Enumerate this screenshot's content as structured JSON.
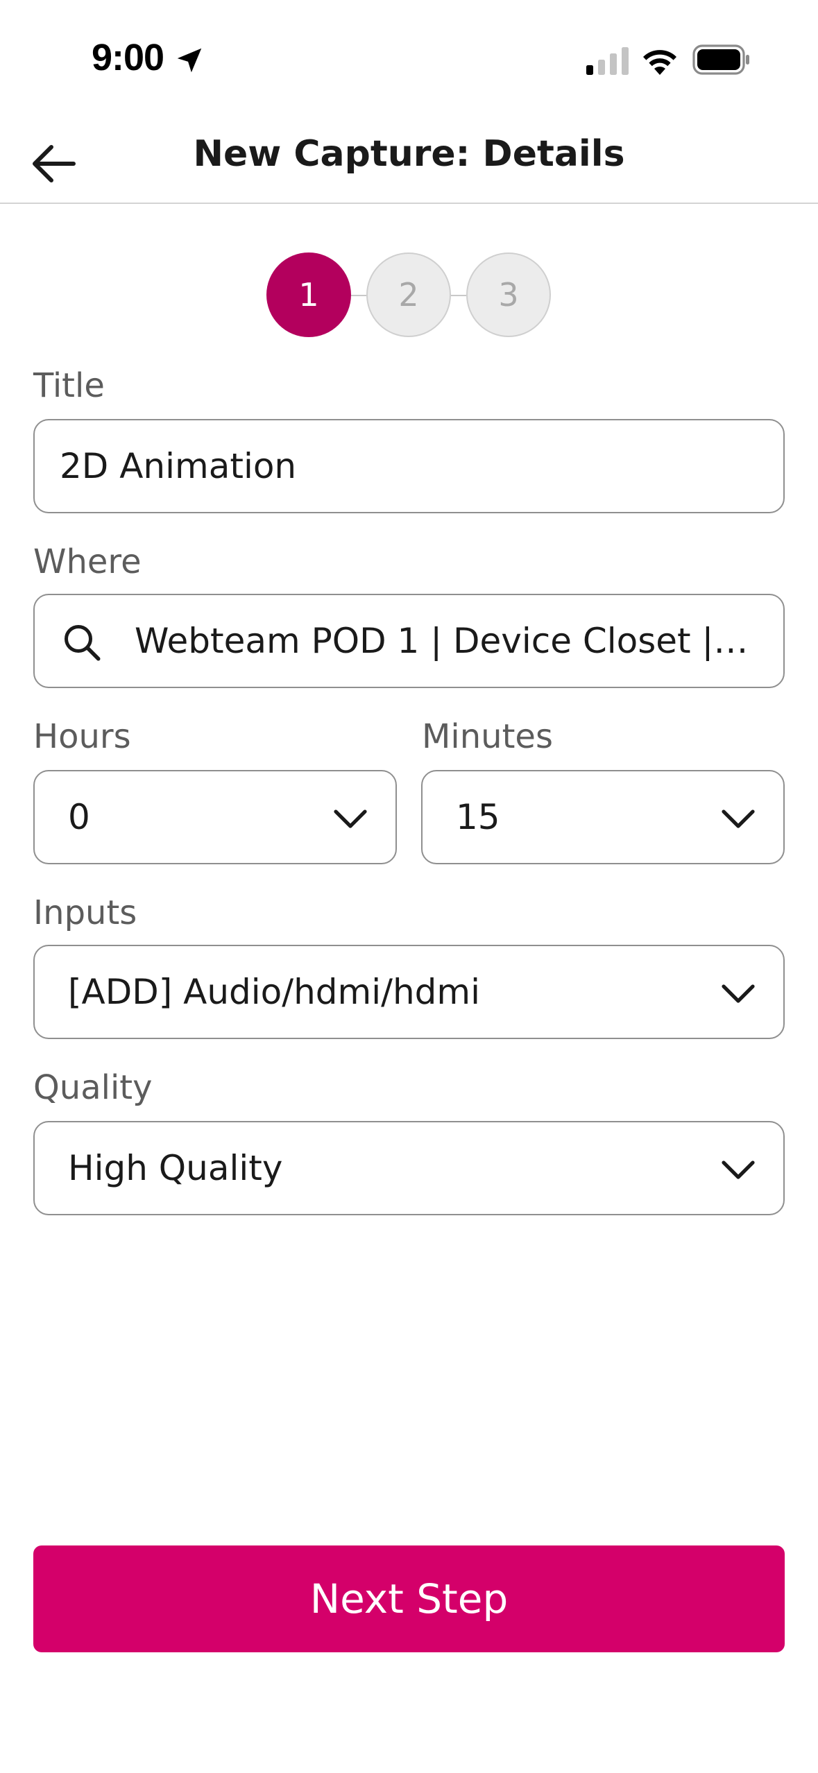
{
  "status_bar": {
    "time": "9:00",
    "icons": [
      "location-arrow-icon",
      "cellular-signal-icon",
      "wifi-icon",
      "battery-icon"
    ]
  },
  "header": {
    "title": "New Capture: Details",
    "back_icon": "arrow-left-icon"
  },
  "stepper": {
    "steps": [
      {
        "label": "1",
        "state": "active"
      },
      {
        "label": "2",
        "state": "inactive"
      },
      {
        "label": "3",
        "state": "inactive"
      }
    ],
    "active_color": "#b3005d"
  },
  "form": {
    "title": {
      "label": "Title",
      "value": "2D Animation"
    },
    "where": {
      "label": "Where",
      "value": "Webteam POD 1 | Device Closet | R...",
      "icon": "search-icon"
    },
    "hours": {
      "label": "Hours",
      "value": "0"
    },
    "minutes": {
      "label": "Minutes",
      "value": "15"
    },
    "inputs": {
      "label": "Inputs",
      "value": "[ADD] Audio/hdmi/hdmi"
    },
    "quality": {
      "label": "Quality",
      "value": "High Quality"
    }
  },
  "actions": {
    "next_label": "Next Step",
    "primary_color": "#d4006a"
  }
}
